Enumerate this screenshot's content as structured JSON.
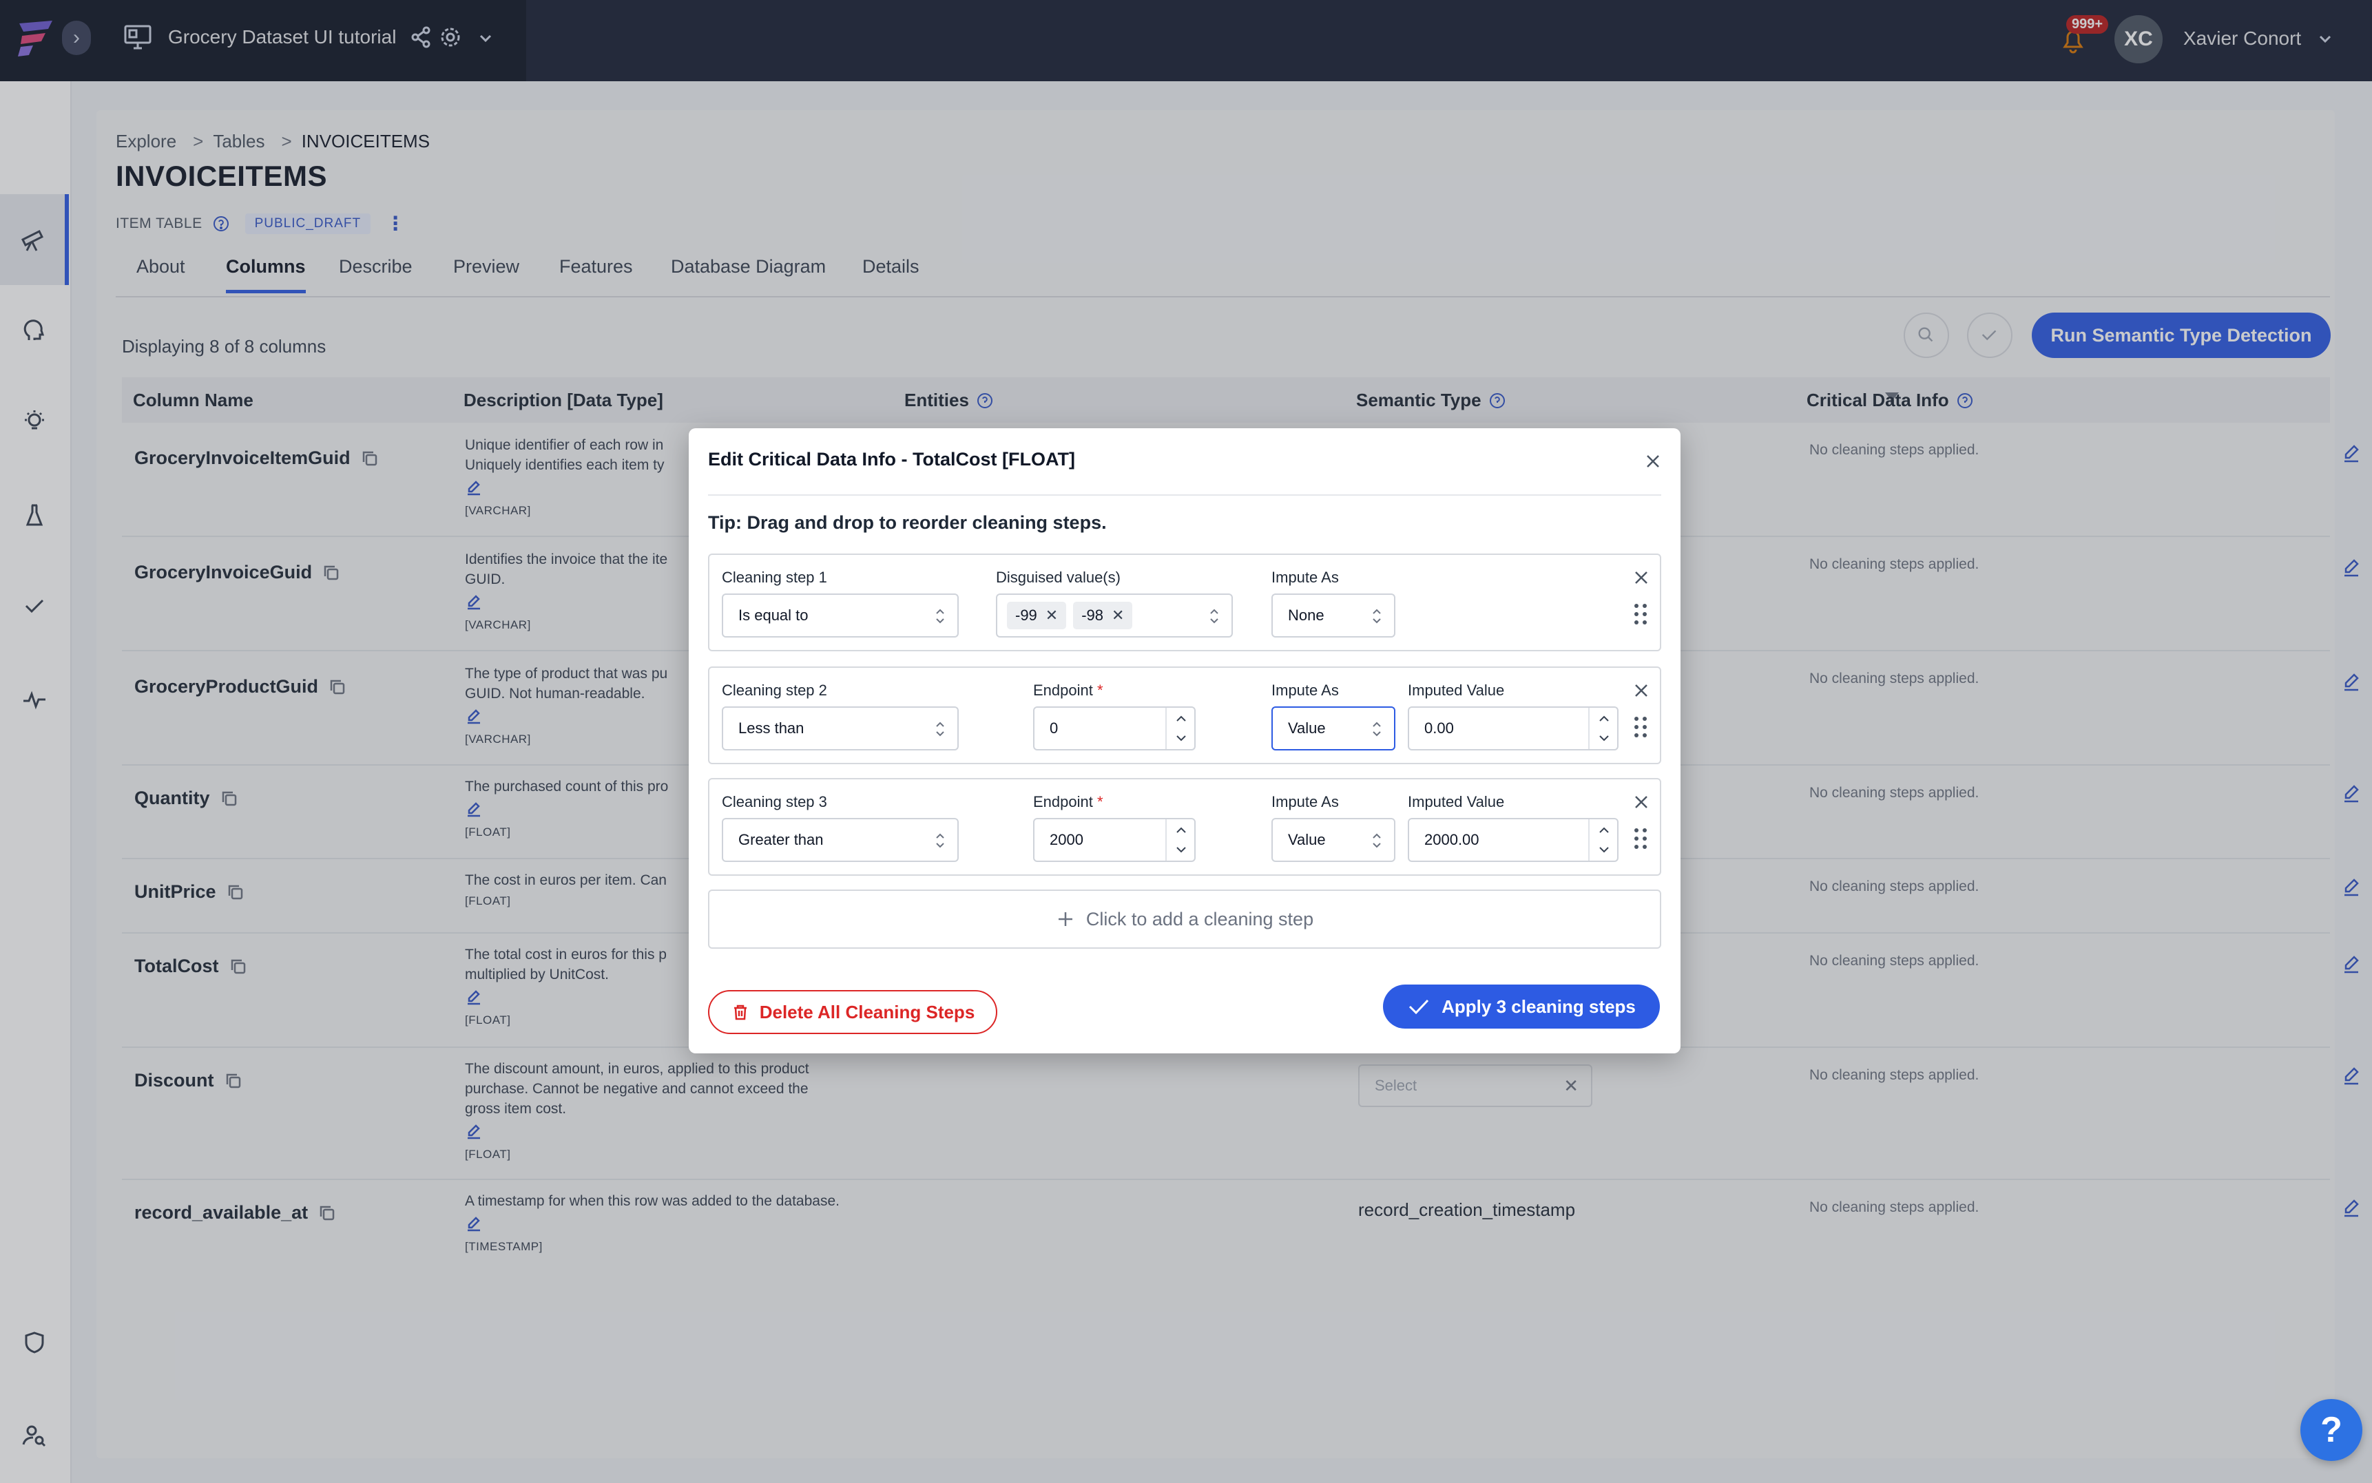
{
  "topbar": {
    "project_title": "Grocery Dataset UI tutorial",
    "notification_count": "999+",
    "user_initials": "XC",
    "user_name": "Xavier Conort"
  },
  "breadcrumb": {
    "explore": "Explore",
    "tables": "Tables",
    "current": "INVOICEITEMS",
    "separator": ">"
  },
  "page": {
    "title": "INVOICEITEMS",
    "table_type": "ITEM TABLE",
    "status_badge": "PUBLIC_DRAFT",
    "kebab": "⋮"
  },
  "tabs": [
    "About",
    "Columns",
    "Describe",
    "Preview",
    "Features",
    "Database Diagram",
    "Details"
  ],
  "toolbar": {
    "display_count": "Displaying 8 of 8 columns",
    "run_button": "Run Semantic Type Detection"
  },
  "table": {
    "headers": {
      "column_name": "Column Name",
      "description": "Description [Data Type]",
      "entities": "Entities",
      "semantic_type": "Semantic Type",
      "critical_data_info": "Critical Data Info"
    },
    "rows": [
      {
        "name": "GroceryInvoiceItemGuid",
        "desc": "Unique identifier of each row in\nUniquely identifies each item ty",
        "dtype": "[VARCHAR]",
        "cdi": "No cleaning steps applied.",
        "semantic": ""
      },
      {
        "name": "GroceryInvoiceGuid",
        "desc": "Identifies the invoice that the ite\nGUID.",
        "dtype": "[VARCHAR]",
        "cdi": "No cleaning steps applied.",
        "semantic": ""
      },
      {
        "name": "GroceryProductGuid",
        "desc": "The type of product that was pu\nGUID. Not human-readable.",
        "dtype": "[VARCHAR]",
        "cdi": "No cleaning steps applied.",
        "semantic": ""
      },
      {
        "name": "Quantity",
        "desc": "The purchased count of this pro",
        "dtype": "[FLOAT]",
        "cdi": "No cleaning steps applied.",
        "semantic": ""
      },
      {
        "name": "UnitPrice",
        "desc": "The cost in euros per item. Can",
        "dtype": "[FLOAT]",
        "cdi": "No cleaning steps applied.",
        "semantic": ""
      },
      {
        "name": "TotalCost",
        "desc": "The total cost in euros for this p\nmultiplied by UnitCost.",
        "dtype": "[FLOAT]",
        "cdi": "No cleaning steps applied.",
        "semantic": ""
      },
      {
        "name": "Discount",
        "desc": "The discount amount, in euros, applied to this product\npurchase. Cannot be negative and cannot exceed the\ngross item cost.",
        "dtype": "[FLOAT]",
        "cdi": "No cleaning steps applied.",
        "semantic_placeholder": "Select"
      },
      {
        "name": "record_available_at",
        "desc": "A timestamp for when this row was added to the database.",
        "dtype": "[TIMESTAMP]",
        "cdi": "No cleaning steps applied.",
        "semantic": "record_creation_timestamp"
      }
    ]
  },
  "modal": {
    "title": "Edit Critical Data Info - TotalCost [FLOAT]",
    "tip": "Tip: Drag and drop to reorder cleaning steps.",
    "steps": [
      {
        "label": "Cleaning step 1",
        "operation": "Is equal to",
        "value_label": "Disguised value(s)",
        "chips": [
          "-99",
          "-98"
        ],
        "impute_label": "Impute As",
        "impute": "None"
      },
      {
        "label": "Cleaning step 2",
        "operation": "Less than",
        "value_label": "Endpoint",
        "endpoint": "0",
        "impute_label": "Impute As",
        "impute": "Value",
        "imputed_label": "Imputed Value",
        "imputed_value": "0.00"
      },
      {
        "label": "Cleaning step 3",
        "operation": "Greater than",
        "value_label": "Endpoint",
        "endpoint": "2000",
        "impute_label": "Impute As",
        "impute": "Value",
        "imputed_label": "Imputed Value",
        "imputed_value": "2000.00"
      }
    ],
    "add_step": "Click to add a cleaning step",
    "delete_all": "Delete All Cleaning Steps",
    "apply": "Apply 3 cleaning steps",
    "required_marker": "*"
  },
  "help_fab": "?",
  "colors": {
    "accent": "#2d5be3",
    "danger": "#dc2626",
    "topbar": "#1b2236"
  }
}
